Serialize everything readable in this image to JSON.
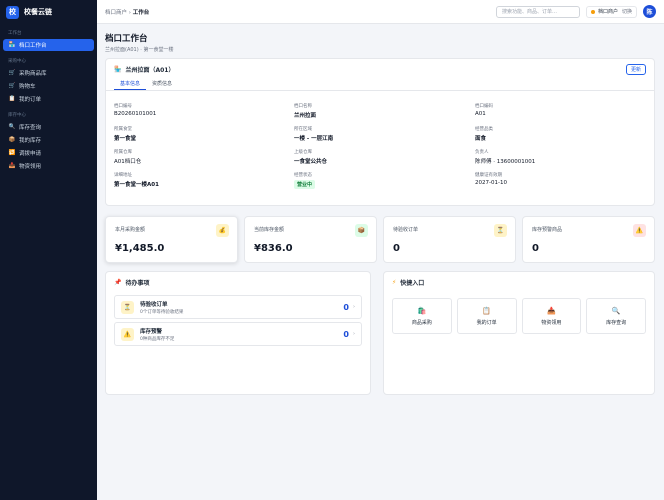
{
  "brand": {
    "logo_text": "校",
    "name": "校餐云链"
  },
  "sidebar": {
    "sections": [
      {
        "title": "工作台",
        "items": [
          {
            "label": "档口工作台",
            "icon": "store-icon",
            "glyph": "🏪",
            "active": true
          }
        ]
      },
      {
        "title": "采购中心",
        "items": [
          {
            "label": "采购商品库",
            "icon": "catalog-icon",
            "glyph": "🛒"
          },
          {
            "label": "购物车",
            "icon": "cart-icon",
            "glyph": "🛒"
          },
          {
            "label": "我的订单",
            "icon": "order-icon",
            "glyph": "📋"
          }
        ]
      },
      {
        "title": "库存中心",
        "items": [
          {
            "label": "库存查询",
            "icon": "search-icon",
            "glyph": "🔍"
          },
          {
            "label": "我的库存",
            "icon": "box-icon",
            "glyph": "📦"
          },
          {
            "label": "调拨申请",
            "icon": "transfer-icon",
            "glyph": "🔁"
          },
          {
            "label": "物资领用",
            "icon": "receive-icon",
            "glyph": "📥"
          }
        ]
      }
    ]
  },
  "topbar": {
    "crumb_parent": "档口商户",
    "crumb_sep": "›",
    "crumb_current": "工作台",
    "search_placeholder": "搜索功能、商品、订单…",
    "store_label": "档口商户",
    "switch_label": "切换",
    "avatar_text": "陈"
  },
  "page": {
    "title": "档口工作台",
    "subtitle": "兰州拉面(A01) · 第一食堂一楼"
  },
  "info": {
    "title": "兰州拉面（A01）",
    "refresh_label": "更新",
    "tabs": [
      {
        "label": "基本信息",
        "active": true
      },
      {
        "label": "资质信息",
        "active": false
      }
    ],
    "fields": [
      {
        "label": "档口编号",
        "value": "B20260101001"
      },
      {
        "label": "档口名称",
        "value": "兰州拉面",
        "bold": true
      },
      {
        "label": "档口编码",
        "value": "A01"
      },
      {
        "label": "所属食堂",
        "value": "第一食堂",
        "bold": true
      },
      {
        "label": "所在区域",
        "value": "一楼 - 一层江南",
        "bold": true
      },
      {
        "label": "经营品类",
        "value": "面食",
        "bold": true
      },
      {
        "label": "所属仓库",
        "value": "A01档口仓"
      },
      {
        "label": "上级仓库",
        "value": "一食堂公共仓",
        "bold": true
      },
      {
        "label": "负责人",
        "value": "陈师傅 · 13600001001"
      },
      {
        "label": "详细地址",
        "value": "第一食堂一楼A01",
        "bold": true
      },
      {
        "label": "经营状态",
        "value": "营业中",
        "badge": true
      },
      {
        "label": "健康证有效期",
        "value": "2027-01-10"
      }
    ]
  },
  "stats": [
    {
      "label": "本月采购金额",
      "value": "¥1,485.0",
      "icon": "money-bag-icon",
      "glyph": "💰",
      "bg": "#fef3c7"
    },
    {
      "label": "当前库存金额",
      "value": "¥836.0",
      "icon": "inventory-icon",
      "glyph": "📦",
      "bg": "#dcfce7"
    },
    {
      "label": "待验收订单",
      "value": "0",
      "icon": "hourglass-icon",
      "glyph": "⏳",
      "bg": "#fef3c7"
    },
    {
      "label": "库存预警商品",
      "value": "0",
      "icon": "warning-icon",
      "glyph": "⚠️",
      "bg": "#fee2e2"
    }
  ],
  "todo": {
    "title": "待办事项",
    "icon": "todo-icon",
    "items": [
      {
        "title": "待验收订单",
        "sub": "0个订单等待验收结果",
        "count": "0",
        "icon": "hourglass-icon",
        "glyph": "⏳"
      },
      {
        "title": "库存预警",
        "sub": "0种商品库存不足",
        "count": "0",
        "icon": "warning-icon",
        "glyph": "⚠️"
      }
    ]
  },
  "quick": {
    "title": "快捷入口",
    "items": [
      {
        "label": "商品采购",
        "icon": "purchase-icon",
        "glyph": "🛍️"
      },
      {
        "label": "我的订单",
        "icon": "order-icon",
        "glyph": "📋"
      },
      {
        "label": "物资领用",
        "icon": "receive-icon",
        "glyph": "📥"
      },
      {
        "label": "库存查询",
        "icon": "search-icon",
        "glyph": "🔍"
      }
    ]
  }
}
